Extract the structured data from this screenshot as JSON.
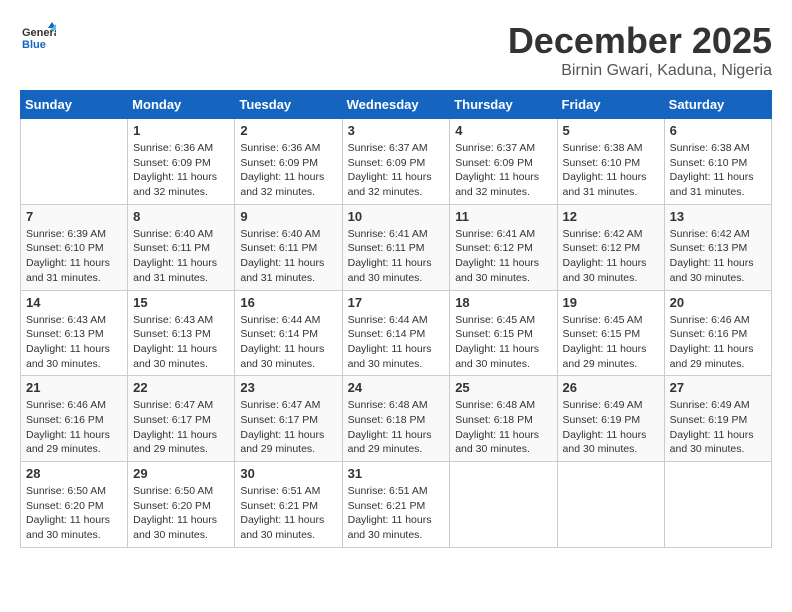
{
  "header": {
    "logo_line1": "General",
    "logo_line2": "Blue",
    "month": "December 2025",
    "location": "Birnin Gwari, Kaduna, Nigeria"
  },
  "weekdays": [
    "Sunday",
    "Monday",
    "Tuesday",
    "Wednesday",
    "Thursday",
    "Friday",
    "Saturday"
  ],
  "weeks": [
    [
      {
        "day": "",
        "info": ""
      },
      {
        "day": "1",
        "info": "Sunrise: 6:36 AM\nSunset: 6:09 PM\nDaylight: 11 hours\nand 32 minutes."
      },
      {
        "day": "2",
        "info": "Sunrise: 6:36 AM\nSunset: 6:09 PM\nDaylight: 11 hours\nand 32 minutes."
      },
      {
        "day": "3",
        "info": "Sunrise: 6:37 AM\nSunset: 6:09 PM\nDaylight: 11 hours\nand 32 minutes."
      },
      {
        "day": "4",
        "info": "Sunrise: 6:37 AM\nSunset: 6:09 PM\nDaylight: 11 hours\nand 32 minutes."
      },
      {
        "day": "5",
        "info": "Sunrise: 6:38 AM\nSunset: 6:10 PM\nDaylight: 11 hours\nand 31 minutes."
      },
      {
        "day": "6",
        "info": "Sunrise: 6:38 AM\nSunset: 6:10 PM\nDaylight: 11 hours\nand 31 minutes."
      }
    ],
    [
      {
        "day": "7",
        "info": "Sunrise: 6:39 AM\nSunset: 6:10 PM\nDaylight: 11 hours\nand 31 minutes."
      },
      {
        "day": "8",
        "info": "Sunrise: 6:40 AM\nSunset: 6:11 PM\nDaylight: 11 hours\nand 31 minutes."
      },
      {
        "day": "9",
        "info": "Sunrise: 6:40 AM\nSunset: 6:11 PM\nDaylight: 11 hours\nand 31 minutes."
      },
      {
        "day": "10",
        "info": "Sunrise: 6:41 AM\nSunset: 6:11 PM\nDaylight: 11 hours\nand 30 minutes."
      },
      {
        "day": "11",
        "info": "Sunrise: 6:41 AM\nSunset: 6:12 PM\nDaylight: 11 hours\nand 30 minutes."
      },
      {
        "day": "12",
        "info": "Sunrise: 6:42 AM\nSunset: 6:12 PM\nDaylight: 11 hours\nand 30 minutes."
      },
      {
        "day": "13",
        "info": "Sunrise: 6:42 AM\nSunset: 6:13 PM\nDaylight: 11 hours\nand 30 minutes."
      }
    ],
    [
      {
        "day": "14",
        "info": "Sunrise: 6:43 AM\nSunset: 6:13 PM\nDaylight: 11 hours\nand 30 minutes."
      },
      {
        "day": "15",
        "info": "Sunrise: 6:43 AM\nSunset: 6:13 PM\nDaylight: 11 hours\nand 30 minutes."
      },
      {
        "day": "16",
        "info": "Sunrise: 6:44 AM\nSunset: 6:14 PM\nDaylight: 11 hours\nand 30 minutes."
      },
      {
        "day": "17",
        "info": "Sunrise: 6:44 AM\nSunset: 6:14 PM\nDaylight: 11 hours\nand 30 minutes."
      },
      {
        "day": "18",
        "info": "Sunrise: 6:45 AM\nSunset: 6:15 PM\nDaylight: 11 hours\nand 30 minutes."
      },
      {
        "day": "19",
        "info": "Sunrise: 6:45 AM\nSunset: 6:15 PM\nDaylight: 11 hours\nand 29 minutes."
      },
      {
        "day": "20",
        "info": "Sunrise: 6:46 AM\nSunset: 6:16 PM\nDaylight: 11 hours\nand 29 minutes."
      }
    ],
    [
      {
        "day": "21",
        "info": "Sunrise: 6:46 AM\nSunset: 6:16 PM\nDaylight: 11 hours\nand 29 minutes."
      },
      {
        "day": "22",
        "info": "Sunrise: 6:47 AM\nSunset: 6:17 PM\nDaylight: 11 hours\nand 29 minutes."
      },
      {
        "day": "23",
        "info": "Sunrise: 6:47 AM\nSunset: 6:17 PM\nDaylight: 11 hours\nand 29 minutes."
      },
      {
        "day": "24",
        "info": "Sunrise: 6:48 AM\nSunset: 6:18 PM\nDaylight: 11 hours\nand 29 minutes."
      },
      {
        "day": "25",
        "info": "Sunrise: 6:48 AM\nSunset: 6:18 PM\nDaylight: 11 hours\nand 30 minutes."
      },
      {
        "day": "26",
        "info": "Sunrise: 6:49 AM\nSunset: 6:19 PM\nDaylight: 11 hours\nand 30 minutes."
      },
      {
        "day": "27",
        "info": "Sunrise: 6:49 AM\nSunset: 6:19 PM\nDaylight: 11 hours\nand 30 minutes."
      }
    ],
    [
      {
        "day": "28",
        "info": "Sunrise: 6:50 AM\nSunset: 6:20 PM\nDaylight: 11 hours\nand 30 minutes."
      },
      {
        "day": "29",
        "info": "Sunrise: 6:50 AM\nSunset: 6:20 PM\nDaylight: 11 hours\nand 30 minutes."
      },
      {
        "day": "30",
        "info": "Sunrise: 6:51 AM\nSunset: 6:21 PM\nDaylight: 11 hours\nand 30 minutes."
      },
      {
        "day": "31",
        "info": "Sunrise: 6:51 AM\nSunset: 6:21 PM\nDaylight: 11 hours\nand 30 minutes."
      },
      {
        "day": "",
        "info": ""
      },
      {
        "day": "",
        "info": ""
      },
      {
        "day": "",
        "info": ""
      }
    ]
  ]
}
